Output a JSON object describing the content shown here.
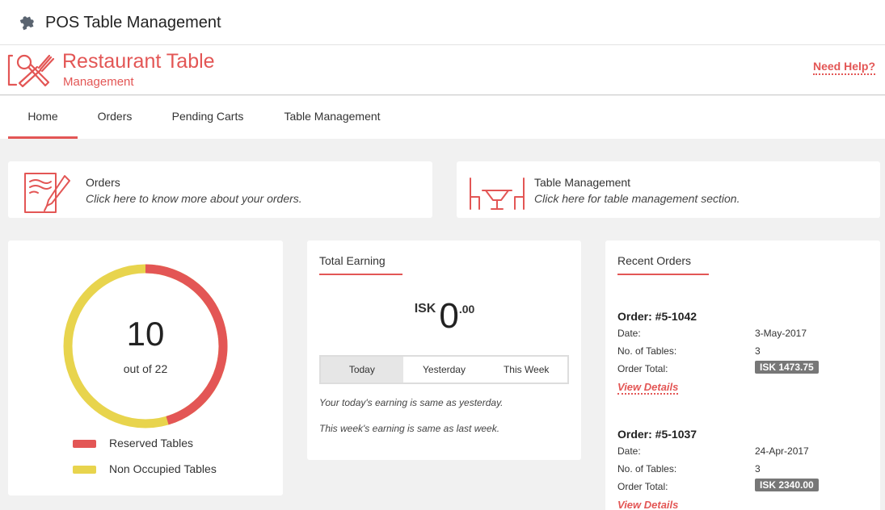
{
  "app": {
    "title": "POS Table Management",
    "icon": "puzzle-icon"
  },
  "brand": {
    "title": "Restaurant Table",
    "subtitle": "Management",
    "help": "Need Help?",
    "accent": "#e35655",
    "logo_icon": "utensils-icon"
  },
  "nav": {
    "tabs": [
      {
        "label": "Home",
        "active": true
      },
      {
        "label": "Orders"
      },
      {
        "label": "Pending Carts"
      },
      {
        "label": "Table Management"
      }
    ]
  },
  "shortcuts": [
    {
      "icon": "order-document-icon",
      "title": "Orders",
      "desc": "Click here to know more about your orders."
    },
    {
      "icon": "dining-table-icon",
      "title": "Table Management",
      "desc": "Click here for table management section."
    }
  ],
  "tables": {
    "reserved": 10,
    "total": 22,
    "count_label": "10",
    "out_of": "out of 22",
    "legend": [
      {
        "label": "Reserved Tables",
        "color": "#e35655"
      },
      {
        "label": "Non Occupied Tables",
        "color": "#e8d44d"
      }
    ]
  },
  "earning": {
    "heading": "Total Earning",
    "currency": "ISK",
    "integer": "0",
    "decimal": ".00",
    "periods": [
      "Today",
      "Yesterday",
      "This Week"
    ],
    "active_period": "Today",
    "notes": [
      "Your today's earning is same as yesterday.",
      "This week's earning is same as last week."
    ]
  },
  "recent": {
    "heading": "Recent Orders",
    "labels": {
      "date": "Date:",
      "tables": "No. of Tables:",
      "total": "Order Total:",
      "view": "View Details"
    },
    "orders": [
      {
        "id": "Order: #5-1042",
        "date": "3-May-2017",
        "tables": "3",
        "total": "ISK 1473.75"
      },
      {
        "id": "Order: #5-1037",
        "date": "24-Apr-2017",
        "tables": "3",
        "total": "ISK 2340.00"
      }
    ]
  }
}
